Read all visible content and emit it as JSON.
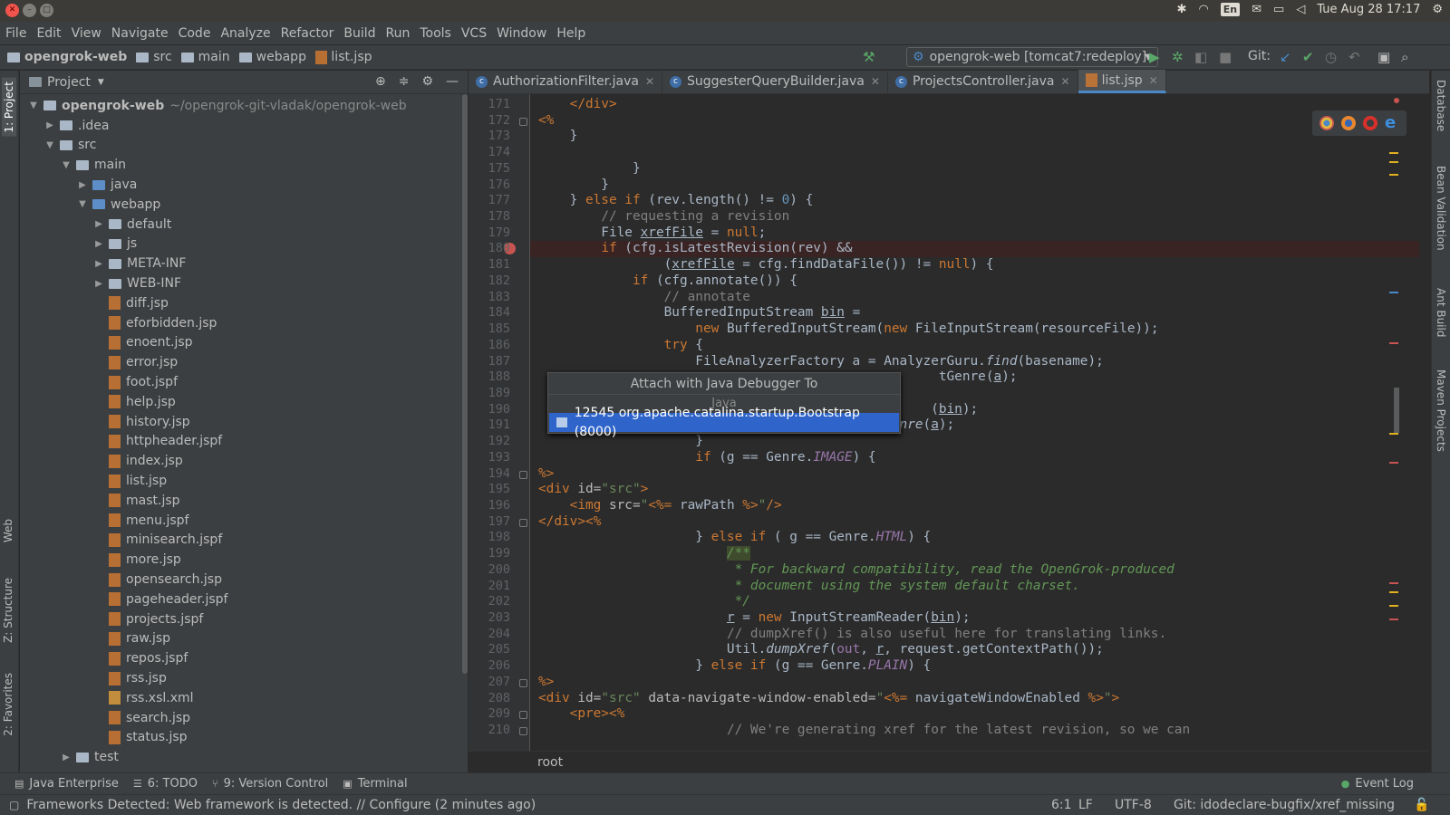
{
  "os": {
    "datetime": "Tue Aug 28 17:17",
    "lang": "En"
  },
  "menu": [
    "File",
    "Edit",
    "View",
    "Navigate",
    "Code",
    "Analyze",
    "Refactor",
    "Build",
    "Run",
    "Tools",
    "VCS",
    "Window",
    "Help"
  ],
  "breadcrumbs": [
    "opengrok-web",
    "src",
    "main",
    "webapp",
    "list.jsp"
  ],
  "toolbar": {
    "run_config": "opengrok-web [tomcat7:redeploy]",
    "git_label": "Git:"
  },
  "left_strip": {
    "project": "1: Project",
    "web": "Web",
    "structure": "Z: Structure",
    "favorites": "2: Favorites"
  },
  "right_strip": {
    "database": "Database",
    "bean": "Bean Validation",
    "ant": "Ant Build",
    "maven": "Maven Projects"
  },
  "project_panel": {
    "title": "Project",
    "tree": [
      {
        "depth": 0,
        "arrow": "▼",
        "type": "module",
        "name": "opengrok-web",
        "extra": "~/opengrok-git-vladak/opengrok-web"
      },
      {
        "depth": 1,
        "arrow": "▶",
        "type": "folder",
        "name": ".idea"
      },
      {
        "depth": 1,
        "arrow": "▼",
        "type": "folder",
        "name": "src"
      },
      {
        "depth": 2,
        "arrow": "▼",
        "type": "folder",
        "name": "main"
      },
      {
        "depth": 3,
        "arrow": "▶",
        "type": "folder-blue",
        "name": "java"
      },
      {
        "depth": 3,
        "arrow": "▼",
        "type": "folder-blue",
        "name": "webapp"
      },
      {
        "depth": 4,
        "arrow": "▶",
        "type": "folder",
        "name": "default"
      },
      {
        "depth": 4,
        "arrow": "▶",
        "type": "folder",
        "name": "js"
      },
      {
        "depth": 4,
        "arrow": "▶",
        "type": "folder",
        "name": "META-INF"
      },
      {
        "depth": 4,
        "arrow": "▶",
        "type": "folder",
        "name": "WEB-INF"
      },
      {
        "depth": 4,
        "arrow": "",
        "type": "jsp",
        "name": "diff.jsp"
      },
      {
        "depth": 4,
        "arrow": "",
        "type": "jsp",
        "name": "eforbidden.jsp"
      },
      {
        "depth": 4,
        "arrow": "",
        "type": "jsp",
        "name": "enoent.jsp"
      },
      {
        "depth": 4,
        "arrow": "",
        "type": "jsp",
        "name": "error.jsp"
      },
      {
        "depth": 4,
        "arrow": "",
        "type": "jsp",
        "name": "foot.jspf"
      },
      {
        "depth": 4,
        "arrow": "",
        "type": "jsp",
        "name": "help.jsp"
      },
      {
        "depth": 4,
        "arrow": "",
        "type": "jsp",
        "name": "history.jsp"
      },
      {
        "depth": 4,
        "arrow": "",
        "type": "jsp",
        "name": "httpheader.jspf"
      },
      {
        "depth": 4,
        "arrow": "",
        "type": "jsp",
        "name": "index.jsp"
      },
      {
        "depth": 4,
        "arrow": "",
        "type": "jsp",
        "name": "list.jsp"
      },
      {
        "depth": 4,
        "arrow": "",
        "type": "jsp",
        "name": "mast.jsp"
      },
      {
        "depth": 4,
        "arrow": "",
        "type": "jsp",
        "name": "menu.jspf"
      },
      {
        "depth": 4,
        "arrow": "",
        "type": "jsp",
        "name": "minisearch.jspf"
      },
      {
        "depth": 4,
        "arrow": "",
        "type": "jsp",
        "name": "more.jsp"
      },
      {
        "depth": 4,
        "arrow": "",
        "type": "jsp",
        "name": "opensearch.jsp"
      },
      {
        "depth": 4,
        "arrow": "",
        "type": "jsp",
        "name": "pageheader.jspf"
      },
      {
        "depth": 4,
        "arrow": "",
        "type": "jsp",
        "name": "projects.jspf"
      },
      {
        "depth": 4,
        "arrow": "",
        "type": "jsp",
        "name": "raw.jsp"
      },
      {
        "depth": 4,
        "arrow": "",
        "type": "jsp",
        "name": "repos.jspf"
      },
      {
        "depth": 4,
        "arrow": "",
        "type": "jsp",
        "name": "rss.jsp"
      },
      {
        "depth": 4,
        "arrow": "",
        "type": "xml",
        "name": "rss.xsl.xml"
      },
      {
        "depth": 4,
        "arrow": "",
        "type": "jsp",
        "name": "search.jsp"
      },
      {
        "depth": 4,
        "arrow": "",
        "type": "jsp",
        "name": "status.jsp"
      },
      {
        "depth": 2,
        "arrow": "▶",
        "type": "folder",
        "name": "test"
      }
    ]
  },
  "tabs": [
    {
      "label": "AuthorizationFilter.java",
      "kind": "class",
      "active": false
    },
    {
      "label": "SuggesterQueryBuilder.java",
      "kind": "class",
      "active": false
    },
    {
      "label": "ProjectsController.java",
      "kind": "class",
      "active": false
    },
    {
      "label": "list.jsp",
      "kind": "jsp",
      "active": true
    }
  ],
  "code": {
    "breakpoint_line": "180",
    "lines": [
      {
        "n": "171",
        "h": "    <span class=\"kw\">&lt;/div&gt;</span>"
      },
      {
        "n": "172",
        "h": "<span class=\"jsp\">&lt;%</span>"
      },
      {
        "n": "173",
        "h": "    }"
      },
      {
        "n": "174",
        "h": ""
      },
      {
        "n": "175",
        "h": "            }"
      },
      {
        "n": "176",
        "h": "        }"
      },
      {
        "n": "177",
        "h": "    } <span class=\"kw\">else if</span> (rev.length() != <span style=\"color:#6897bb\">0</span>) {"
      },
      {
        "n": "178",
        "h": "        <span class=\"cm\">// requesting a revision</span>"
      },
      {
        "n": "179",
        "h": "        File <span class=\"u\">xrefFile</span> = <span class=\"kw\">null</span>;"
      },
      {
        "n": "180",
        "h": "        <span class=\"kw\">if</span> (cfg.isLatestRevision(rev) &amp;&amp;"
      },
      {
        "n": "181",
        "h": "                (<span class=\"u\">xrefFile</span> = cfg.findDataFile()) != <span class=\"kw\">null</span>) {"
      },
      {
        "n": "182",
        "h": "            <span class=\"kw\">if</span> (cfg.annotate()) {"
      },
      {
        "n": "183",
        "h": "                <span class=\"cm\">// annotate</span>"
      },
      {
        "n": "184",
        "h": "                BufferedInputStream <span class=\"u\">bin</span> ="
      },
      {
        "n": "185",
        "h": "                    <span class=\"kw\">new</span> BufferedInputStream(<span class=\"kw\">new</span> FileInputStream(resourceFile));"
      },
      {
        "n": "186",
        "h": "                <span class=\"kw\">try</span> {"
      },
      {
        "n": "187",
        "h": "                    FileAnalyzerFactory a = AnalyzerGuru.<span class=\"fn\">find</span>(basename);"
      },
      {
        "n": "188",
        "h": "                                                   tGenre(<span class=\"u\">a</span>);"
      },
      {
        "n": "189",
        "h": ""
      },
      {
        "n": "190",
        "h": "                                                  (<span class=\"u\">bin</span>);"
      },
      {
        "n": "191",
        "h": "                        g = AnalyzerGuru.<span class=\"fn\">getGenre</span>(<span class=\"u\">a</span>);"
      },
      {
        "n": "192",
        "h": "                    }"
      },
      {
        "n": "193",
        "h": "                    <span class=\"kw\">if</span> (g == Genre.<span class=\"it\">IMAGE</span>) {"
      },
      {
        "n": "194",
        "h": "<span class=\"jsp\">%&gt;</span>"
      },
      {
        "n": "195",
        "h": "<span class=\"kw\">&lt;div</span> <span style=\"color:#bababa\">id=</span><span class=\"st\">\"src\"</span><span class=\"kw\">&gt;</span>"
      },
      {
        "n": "196",
        "h": "    <span class=\"kw\">&lt;img</span> <span style=\"color:#bababa\">src=</span><span class=\"st\">\"</span><span class=\"jsp\">&lt;%=</span> rawPath <span class=\"jsp\">%&gt;</span><span class=\"st\">\"</span><span class=\"kw\">/&gt;</span>"
      },
      {
        "n": "197",
        "h": "<span class=\"kw\">&lt;/div&gt;</span><span class=\"jsp\">&lt;%</span>"
      },
      {
        "n": "198",
        "h": "                    } <span class=\"kw\">else if</span> ( g == Genre.<span class=\"it\">HTML</span>) {"
      },
      {
        "n": "199",
        "h": "                        <span class=\"dc\" style=\"background:#3f4b2d\">/**</span>"
      },
      {
        "n": "200",
        "h": "                         <span class=\"dc\">* For backward compatibility, read the OpenGrok-produced</span>"
      },
      {
        "n": "201",
        "h": "                         <span class=\"dc\">* document using the system default charset.</span>"
      },
      {
        "n": "202",
        "h": "                         <span class=\"dc\">*/</span>"
      },
      {
        "n": "203",
        "h": "                        <span class=\"u\">r</span> = <span class=\"kw\">new</span> InputStreamReader(<span class=\"u\">bin</span>);"
      },
      {
        "n": "204",
        "h": "                        <span class=\"cm\">// dumpXref() is also useful here for translating links.</span>"
      },
      {
        "n": "205",
        "h": "                        Util.<span class=\"fn\">dumpXref</span>(<span style=\"color:#9876aa\">out</span>, <span class=\"u\">r</span>, request.getContextPath());"
      },
      {
        "n": "206",
        "h": "                    } <span class=\"kw\">else if</span> (g == Genre.<span class=\"it\">PLAIN</span>) {"
      },
      {
        "n": "207",
        "h": "<span class=\"jsp\">%&gt;</span>"
      },
      {
        "n": "208",
        "h": "<span class=\"kw\">&lt;div</span> <span style=\"color:#bababa\">id=</span><span class=\"st\">\"src\"</span> <span style=\"color:#bababa\">data-navigate-window-enabled=</span><span class=\"st\">\"</span><span class=\"jsp\">&lt;%=</span> navigateWindowEnabled <span class=\"jsp\">%&gt;</span><span class=\"st\">\"</span><span class=\"kw\">&gt;</span>"
      },
      {
        "n": "209",
        "h": "    <span class=\"kw\">&lt;pre&gt;</span><span class=\"jsp\">&lt;%</span>"
      },
      {
        "n": "210",
        "h": "                        <span class=\"cm\">// We're generating xref for the latest revision, so we can</span>"
      }
    ]
  },
  "popup": {
    "title": "Attach with Java Debugger To",
    "group": "Java",
    "item": "12545 org.apache.catalina.startup.Bootstrap (8000)"
  },
  "editor_breadcrumb": "root",
  "bottom_tabs": {
    "java_ent": "Java Enterprise",
    "todo": "6: TODO",
    "vcs": "9: Version Control",
    "terminal": "Terminal",
    "event_log": "Event Log"
  },
  "status": {
    "message": "Frameworks Detected: Web framework is detected. // Configure (2 minutes ago)",
    "position": "6:1",
    "line_sep": "LF",
    "encoding": "UTF-8",
    "git_branch": "Git: idodeclare-bugfix/xref_missing"
  },
  "colors": {
    "breakpoint": "#c75450",
    "popup_selected": "#2f65ca",
    "tab_underline": "#4a88c7"
  }
}
